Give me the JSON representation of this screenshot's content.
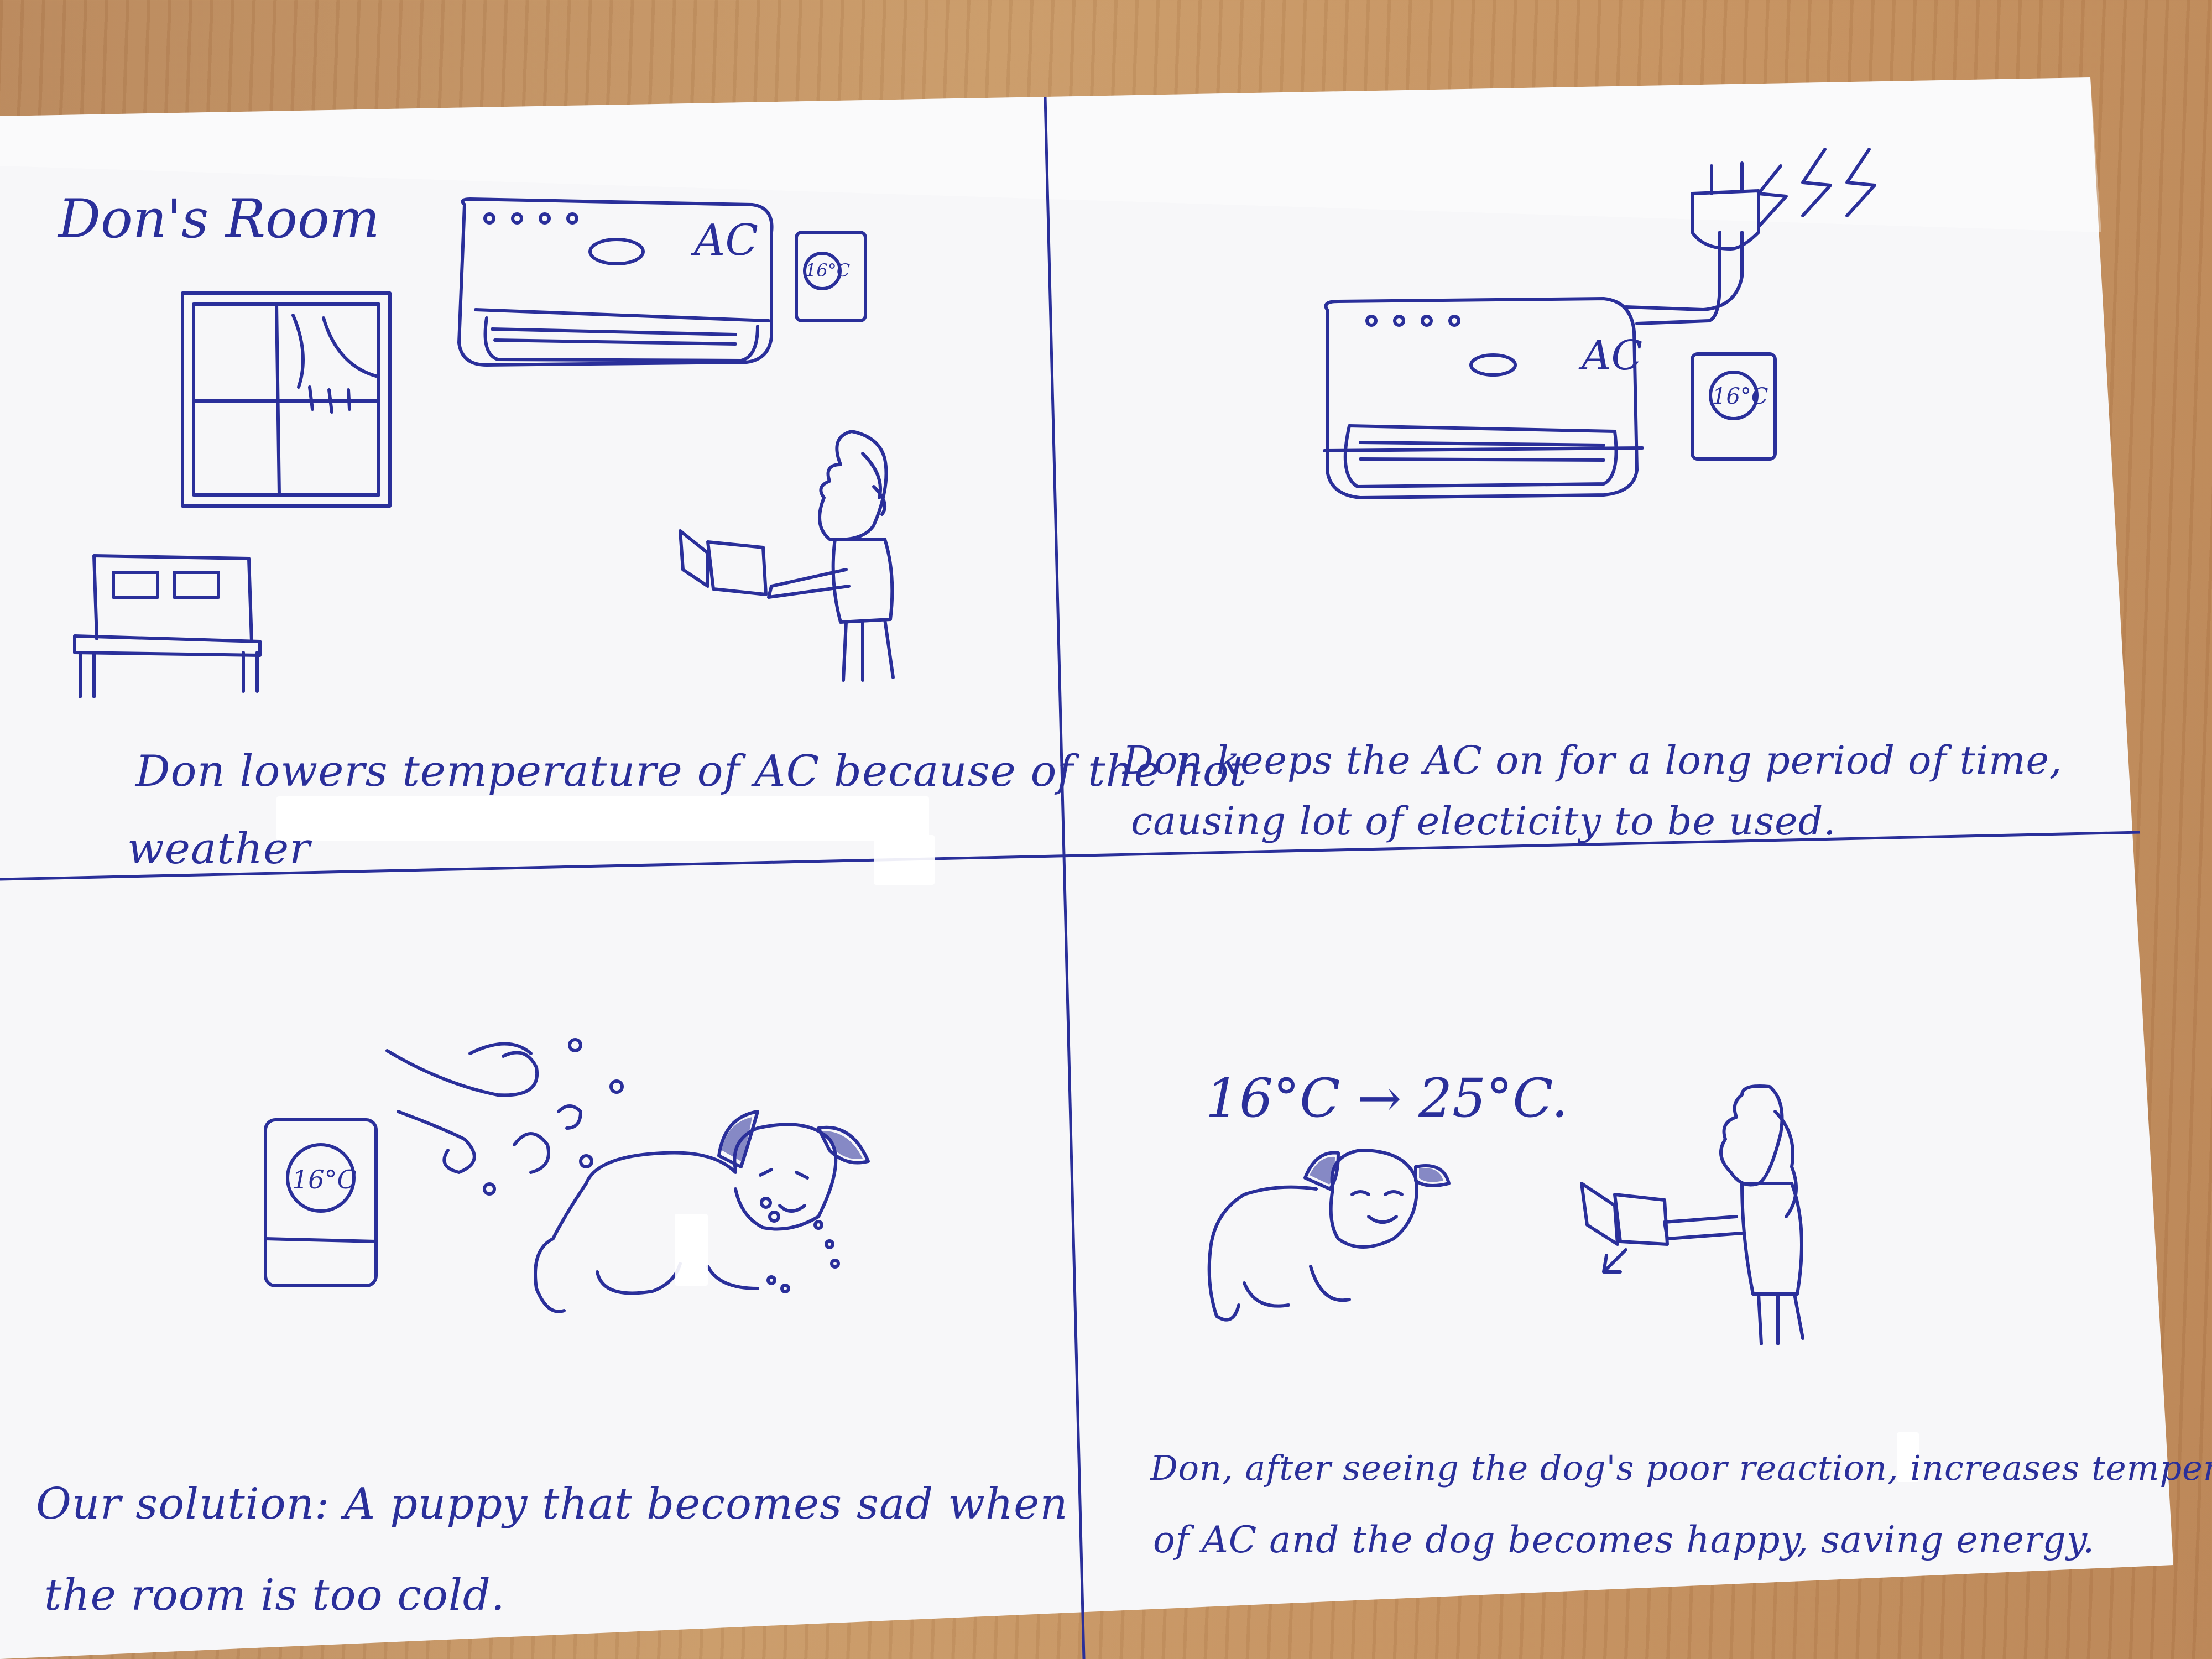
{
  "panels": {
    "top_left": {
      "room_label": "Don's Room",
      "ac_label": "AC",
      "thermostat_value": "16°C",
      "caption_line1": "Don lowers temperature of AC because of the hot",
      "caption_line2": "weather"
    },
    "top_right": {
      "ac_label": "AC",
      "thermostat_value": "16°C",
      "caption_line1": "Don keeps the AC on for a long period of time,",
      "caption_line2": "causing lot of electicity to be used."
    },
    "bottom_left": {
      "thermostat_value": "16°C",
      "caption_line1": "Our solution: A puppy that becomes sad when",
      "caption_line2": "the room is too cold."
    },
    "bottom_right": {
      "temperature_change": "16°C → 25°C.",
      "caption_line1": "Don, after seeing the dog's poor reaction, increases temperature",
      "caption_line2": "of AC and the dog becomes happy, saving energy."
    }
  },
  "colors": {
    "ink": "#2a2f9a",
    "paper": "#f6f6f8",
    "table": "#c4905e"
  }
}
